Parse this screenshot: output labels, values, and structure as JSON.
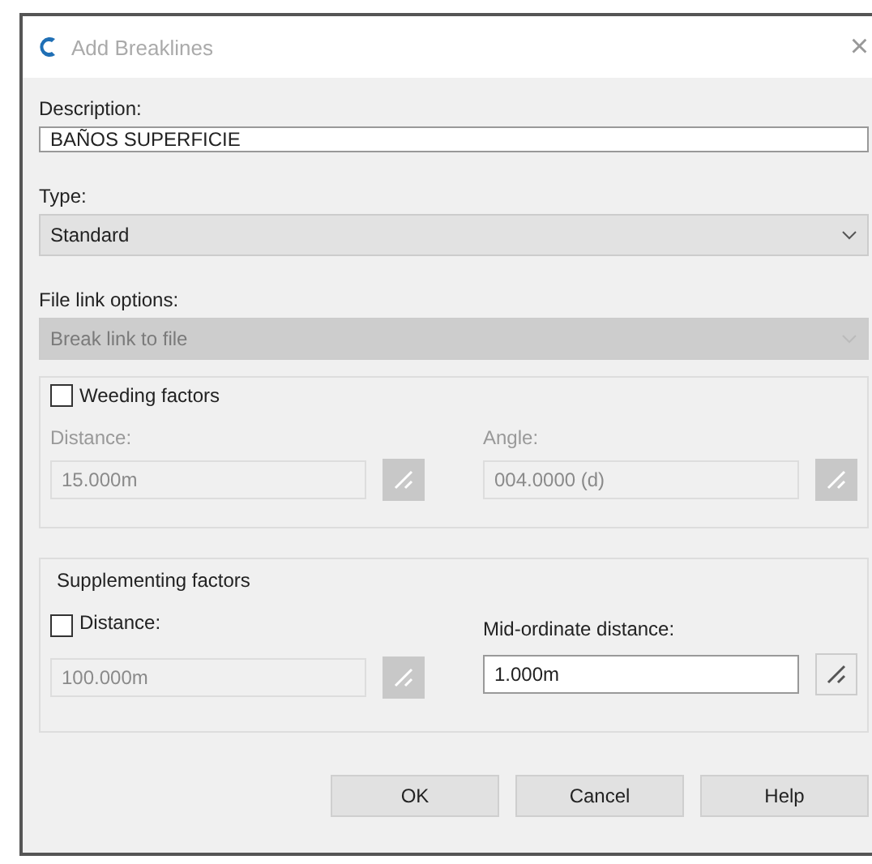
{
  "window": {
    "title": "Add Breaklines",
    "close": "×"
  },
  "description": {
    "label": "Description:",
    "value": "BAÑOS SUPERFICIE"
  },
  "type": {
    "label": "Type:",
    "value": "Standard",
    "disabled": false
  },
  "file_link": {
    "label": "File link options:",
    "value": "Break link to file",
    "disabled": true
  },
  "weeding": {
    "label": "Weeding factors",
    "checked": false,
    "fields": [
      {
        "label": "Distance:",
        "value": "15.000m",
        "disabled": true
      },
      {
        "label": "Angle:",
        "value": "004.0000 (d)",
        "disabled": true
      }
    ]
  },
  "supplementing": {
    "title": "Supplementing factors",
    "distance": {
      "label": "Distance:",
      "checked": false,
      "value": "100.000m",
      "disabled": true
    },
    "mid_ordinate": {
      "label": "Mid-ordinate distance:",
      "value": "1.000m",
      "disabled": false
    }
  },
  "buttons": [
    "OK",
    "Cancel",
    "Help"
  ]
}
